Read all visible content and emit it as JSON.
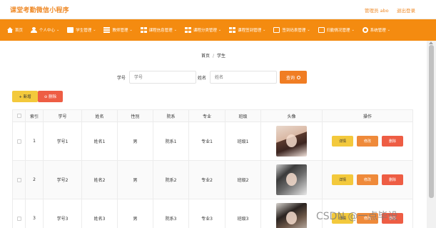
{
  "header": {
    "title": "课堂考勤微信小程序",
    "user": "管理员 abo",
    "logout": "退出登录"
  },
  "nav": {
    "items": [
      {
        "label": "首页",
        "icon": "home-icon",
        "has_menu": false
      },
      {
        "label": "个人中心",
        "icon": "user-icon",
        "has_menu": true
      },
      {
        "label": "学生管理",
        "icon": "box-icon",
        "has_menu": true
      },
      {
        "label": "教师管理",
        "icon": "list-icon",
        "has_menu": true
      },
      {
        "label": "课程信息管理",
        "icon": "grid-icon",
        "has_menu": true
      },
      {
        "label": "课程分类管理",
        "icon": "grid-icon",
        "has_menu": true
      },
      {
        "label": "课程签到管理",
        "icon": "grid-icon",
        "has_menu": true
      },
      {
        "label": "签到码表管理",
        "icon": "calendar-icon",
        "has_menu": true
      },
      {
        "label": "归勤情况管理",
        "icon": "calendar-icon",
        "has_menu": true
      },
      {
        "label": "系统管理",
        "icon": "gear-icon",
        "has_menu": true
      }
    ]
  },
  "breadcrumb": {
    "home": "首页",
    "separator": "/",
    "current": "学生"
  },
  "search": {
    "student_no_label": "学号",
    "student_no_placeholder": "学号",
    "name_label": "姓名",
    "name_placeholder": "姓名",
    "button": "查询"
  },
  "toolbar": {
    "add": "+ 新增",
    "delete": "⊖ 删除"
  },
  "table": {
    "headers": [
      "",
      "索引",
      "学号",
      "姓名",
      "性别",
      "院系",
      "专业",
      "班级",
      "头像",
      "操作"
    ],
    "rows": [
      {
        "index": "1",
        "student_no": "学号1",
        "name": "姓名1",
        "gender": "男",
        "dept": "院系1",
        "major": "专业1",
        "class": "班级1"
      },
      {
        "index": "2",
        "student_no": "学号2",
        "name": "姓名2",
        "gender": "男",
        "dept": "院系2",
        "major": "专业2",
        "class": "班级2"
      },
      {
        "index": "3",
        "student_no": "学号3",
        "name": "姓名3",
        "gender": "男",
        "dept": "院系3",
        "major": "专业3",
        "class": "班级3"
      }
    ],
    "actions": {
      "detail": "详情",
      "edit": "修改",
      "delete": "删除"
    }
  },
  "watermark": "CSDN @一点毕设",
  "colors": {
    "accent": "#f48b10",
    "title": "#ef8a28",
    "yellow": "#f3c93c",
    "red": "#ee5d44"
  }
}
